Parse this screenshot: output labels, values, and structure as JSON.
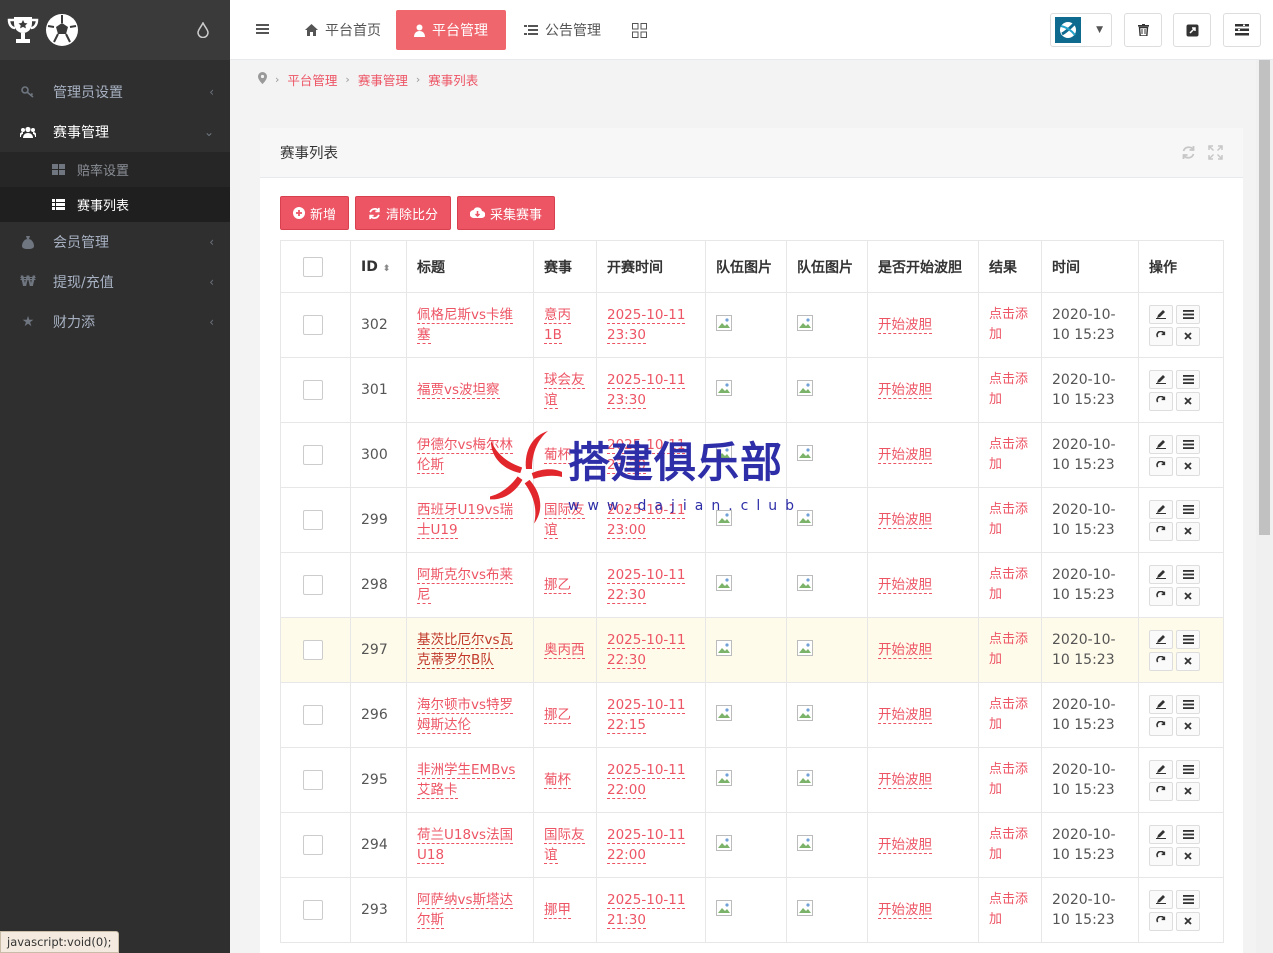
{
  "sidebar": {
    "menu": [
      {
        "label": "管理员设置",
        "icon": "key-icon",
        "active": false
      },
      {
        "label": "赛事管理",
        "icon": "users-icon",
        "active": true
      },
      {
        "label": "会员管理",
        "icon": "money-bag-icon",
        "active": false
      },
      {
        "label": "提现/充值",
        "icon": "yen-icon",
        "active": false
      },
      {
        "label": "财力添",
        "icon": "star-icon",
        "active": false
      }
    ],
    "submenu": [
      {
        "label": "赔率设置",
        "active": false
      },
      {
        "label": "赛事列表",
        "active": true
      }
    ]
  },
  "topbar": {
    "tabs": [
      {
        "label": "平台首页",
        "icon": "home-icon",
        "active": false
      },
      {
        "label": "平台管理",
        "icon": "user-icon",
        "active": true
      },
      {
        "label": "公告管理",
        "icon": "list-icon",
        "active": false
      }
    ]
  },
  "breadcrumb": [
    "平台管理",
    "赛事管理",
    "赛事列表"
  ],
  "panel": {
    "title": "赛事列表",
    "buttons": [
      "新增",
      "清除比分",
      "采集赛事"
    ]
  },
  "table": {
    "headers": [
      "ID",
      "标题",
      "赛事",
      "开赛时间",
      "队伍图片",
      "队伍图片",
      "是否开始波胆",
      "结果",
      "时间",
      "操作"
    ],
    "rows": [
      {
        "id": "302",
        "title": "佩格尼斯vs卡维塞",
        "league": "意丙1B",
        "start": "2025-10-11 23:30",
        "action": "开始波胆",
        "result": "点击添加",
        "time": "2020-10-10 15:23"
      },
      {
        "id": "301",
        "title": "福贾vs波坦察",
        "league": "球会友谊",
        "start": "2025-10-11 23:30",
        "action": "开始波胆",
        "result": "点击添加",
        "time": "2020-10-10 15:23"
      },
      {
        "id": "300",
        "title": "伊德尔vs梅尔林伦斯",
        "league": "葡杯",
        "start": "2025-10-11 23:30",
        "action": "开始波胆",
        "result": "点击添加",
        "time": "2020-10-10 15:23"
      },
      {
        "id": "299",
        "title": "西班牙U19vs瑞士U19",
        "league": "国际友谊",
        "start": "2025-10-11 23:00",
        "action": "开始波胆",
        "result": "点击添加",
        "time": "2020-10-10 15:23"
      },
      {
        "id": "298",
        "title": "阿斯克尔vs布莱尼",
        "league": "挪乙",
        "start": "2025-10-11 22:30",
        "action": "开始波胆",
        "result": "点击添加",
        "time": "2020-10-10 15:23"
      },
      {
        "id": "297",
        "title": "基茨比厄尔vs瓦克蒂罗尔B队",
        "league": "奥丙西",
        "start": "2025-10-11 22:30",
        "action": "开始波胆",
        "result": "点击添加",
        "time": "2020-10-10 15:23"
      },
      {
        "id": "296",
        "title": "海尔顿市vs特罗姆斯达伦",
        "league": "挪乙",
        "start": "2025-10-11 22:15",
        "action": "开始波胆",
        "result": "点击添加",
        "time": "2020-10-10 15:23"
      },
      {
        "id": "295",
        "title": "非洲学生EMBvs艾路卡",
        "league": "葡杯",
        "start": "2025-10-11 22:00",
        "action": "开始波胆",
        "result": "点击添加",
        "time": "2020-10-10 15:23"
      },
      {
        "id": "294",
        "title": "荷兰U18vs法国U18",
        "league": "国际友谊",
        "start": "2025-10-11 22:00",
        "action": "开始波胆",
        "result": "点击添加",
        "time": "2020-10-10 15:23"
      },
      {
        "id": "293",
        "title": "阿萨纳vs斯塔达尔斯",
        "league": "挪甲",
        "start": "2025-10-11 21:30",
        "action": "开始波胆",
        "result": "点击添加",
        "time": "2020-10-10 15:23"
      }
    ]
  },
  "watermark": {
    "title": "搭建俱乐部",
    "sub": "www.dajian.club"
  },
  "status_tip": "javascript:void(0);",
  "colors": {
    "accent": "#ed5565",
    "sidebar": "#2f2f2f",
    "active_tab": "#f0666d"
  }
}
